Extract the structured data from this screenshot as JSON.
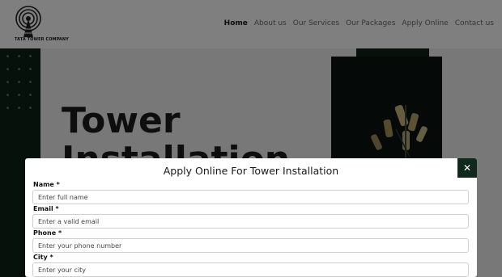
{
  "header": {
    "logo_text": "TATA TOWER COMPANY",
    "nav": [
      {
        "label": "Home",
        "active": true
      },
      {
        "label": "About us",
        "active": false
      },
      {
        "label": "Our Services",
        "active": false
      },
      {
        "label": "Our Packages",
        "active": false
      },
      {
        "label": "Apply Online",
        "active": false
      },
      {
        "label": "Contact us",
        "active": false
      }
    ]
  },
  "hero": {
    "title_line1": "Tower",
    "title_line2": "Installation"
  },
  "modal": {
    "title": "Apply Online For Tower Installation",
    "close_glyph": "✕",
    "fields": [
      {
        "label": "Name *",
        "placeholder": "Enter full name"
      },
      {
        "label": "Email *",
        "placeholder": "Enter a valid email"
      },
      {
        "label": "Phone *",
        "placeholder": "Enter your phone number"
      },
      {
        "label": "City *",
        "placeholder": "Enter your city"
      }
    ]
  },
  "colors": {
    "dark_green": "#0f2a1c",
    "dot_green": "#2f8a5a"
  }
}
